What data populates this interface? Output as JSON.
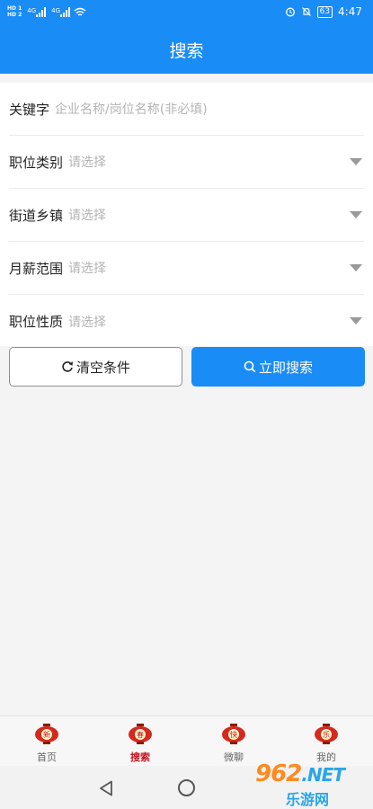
{
  "status_bar": {
    "sim1": "HD 1",
    "sim2": "HD 2",
    "network1": "4G",
    "network2": "4G",
    "battery": "63",
    "time": "4:47"
  },
  "header": {
    "title": "搜索"
  },
  "form": {
    "keyword": {
      "label": "关键字",
      "placeholder": "企业名称/岗位名称(非必填)"
    },
    "rows": [
      {
        "label": "职位类别",
        "placeholder": "请选择"
      },
      {
        "label": "街道乡镇",
        "placeholder": "请选择"
      },
      {
        "label": "月薪范围",
        "placeholder": "请选择"
      },
      {
        "label": "职位性质",
        "placeholder": "请选择"
      }
    ]
  },
  "actions": {
    "clear_label": "清空条件",
    "search_label": "立即搜索"
  },
  "tabs": [
    {
      "label": "首页",
      "badge": "新",
      "active": false
    },
    {
      "label": "搜索",
      "badge": "春",
      "active": true
    },
    {
      "label": "微聊",
      "badge": "快",
      "active": false
    },
    {
      "label": "我的",
      "badge": "乐",
      "active": false
    }
  ],
  "watermark": {
    "logo": "962",
    "suffix": ".NET",
    "text": "乐游网"
  },
  "colors": {
    "primary": "#1a8cf5",
    "active_tab": "#c1121f",
    "lantern": "#d42a1e"
  }
}
